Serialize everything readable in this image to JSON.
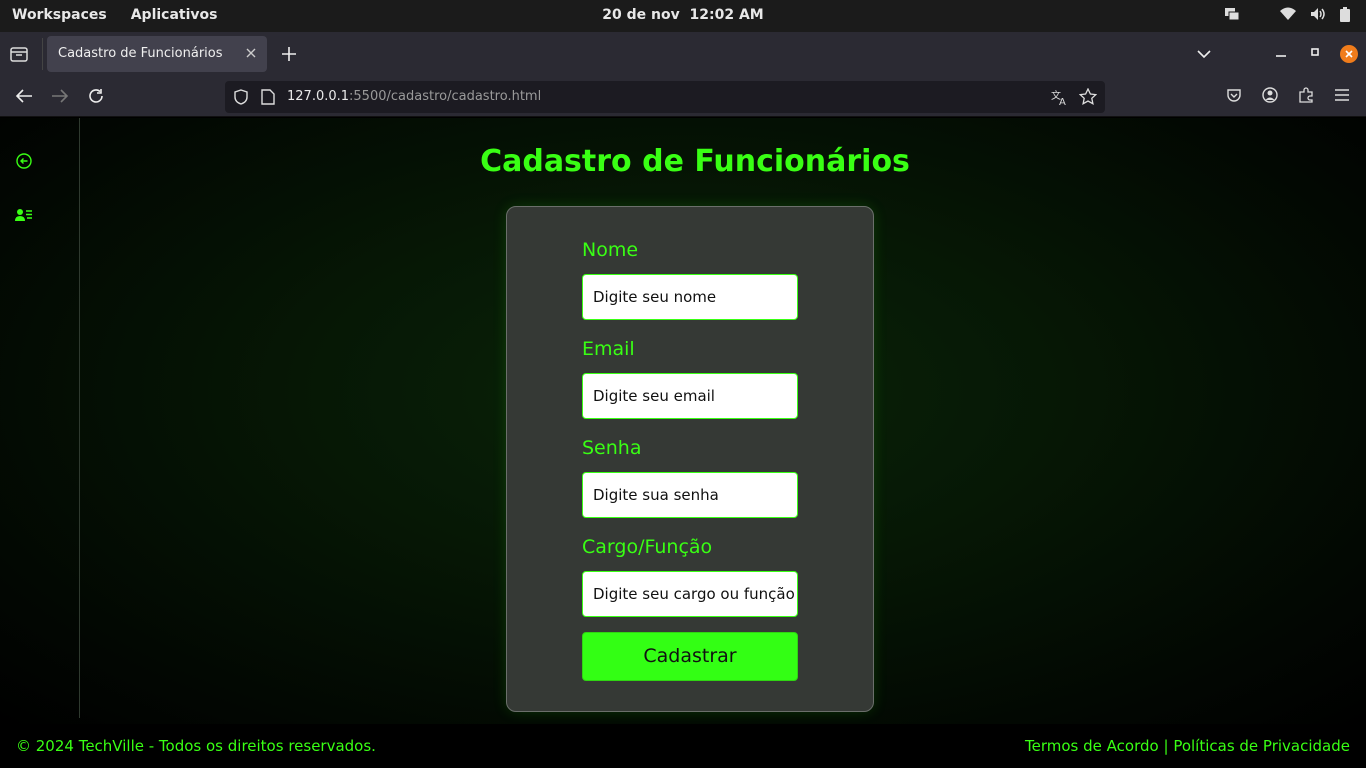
{
  "os": {
    "workspaces": "Workspaces",
    "apps": "Aplicativos",
    "date": "20 de nov",
    "time": "12:02 AM"
  },
  "browser": {
    "tab_title": "Cadastro de Funcionários",
    "url_host": "127.0.0.1",
    "url_rest": ":5500/cadastro/cadastro.html"
  },
  "page": {
    "title": "Cadastro de Funcionários",
    "fields": [
      {
        "label": "Nome",
        "placeholder": "Digite seu nome"
      },
      {
        "label": "Email",
        "placeholder": "Digite seu email"
      },
      {
        "label": "Senha",
        "placeholder": "Digite sua senha"
      },
      {
        "label": "Cargo/Função",
        "placeholder": "Digite seu cargo ou função"
      }
    ],
    "submit_label": "Cadastrar"
  },
  "footer": {
    "copyright": "© 2024 TechVille - Todos os direitos reservados.",
    "terms": "Termos de Acordo",
    "separator": "|",
    "privacy": "Políticas de Privacidade"
  },
  "colors": {
    "accent": "#39ff14",
    "card_bg": "#353935",
    "button_bg": "#33ff14"
  },
  "icons": {
    "sidebar_back": "arrow-left-circle-icon",
    "sidebar_users": "users-list-icon"
  }
}
